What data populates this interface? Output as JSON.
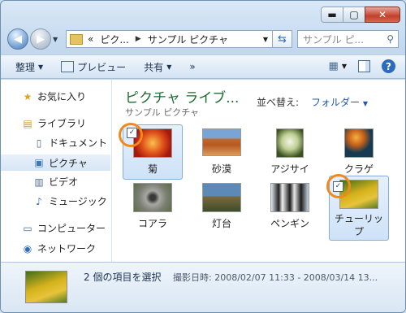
{
  "window": {
    "address_crumbs": [
      "«",
      "ピク...",
      "サンプル ピクチャ"
    ],
    "search_placeholder": "サンプル ピ..."
  },
  "toolbar": {
    "organize": "整理",
    "preview": "プレビュー",
    "share": "共有",
    "more": "»"
  },
  "nav": {
    "favorites": "お気に入り",
    "libraries": "ライブラリ",
    "documents": "ドキュメント",
    "pictures": "ピクチャ",
    "videos": "ビデオ",
    "music": "ミュージック",
    "computer": "コンピューター",
    "network": "ネットワーク"
  },
  "content": {
    "library_title": "ピクチャ ライブ...",
    "library_subtitle": "サンプル ピクチャ",
    "arrange_label": "並べ替え:",
    "arrange_value": "フォルダー"
  },
  "items": [
    {
      "label": "菊",
      "selected": true
    },
    {
      "label": "砂漠",
      "selected": false
    },
    {
      "label": "アジサイ",
      "selected": false
    },
    {
      "label": "クラゲ",
      "selected": false
    },
    {
      "label": "コアラ",
      "selected": false
    },
    {
      "label": "灯台",
      "selected": false
    },
    {
      "label": "ペンギン",
      "selected": false
    },
    {
      "label": "チューリップ",
      "selected": true
    }
  ],
  "details": {
    "selection": "2 個の項目を選択",
    "date_label": "撮影日時:",
    "date_value": "2008/02/07 11:33 - 2008/03/14 13..."
  },
  "colors": {
    "highlight_ring": "#f08a1c",
    "library_title": "#1e6b2f"
  }
}
